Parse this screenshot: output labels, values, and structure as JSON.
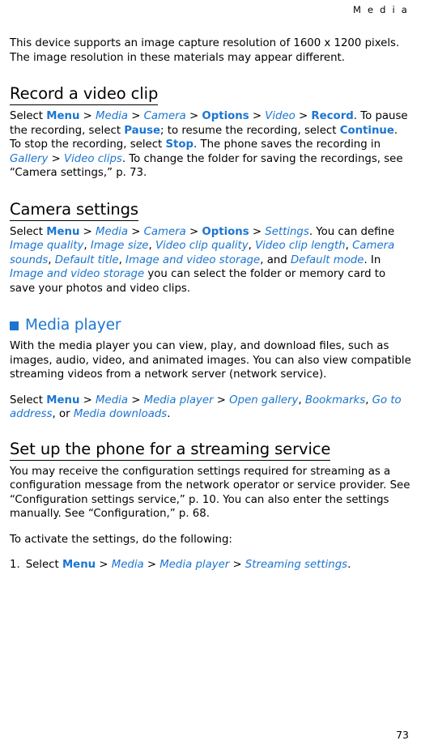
{
  "header": {
    "running_head": "M e d i a"
  },
  "intro": {
    "text": "This device supports an image capture resolution of 1600 x 1200 pixels. The image resolution in these materials may appear different."
  },
  "sections": {
    "record_video": {
      "heading": "Record a video clip",
      "p1_a": "Select ",
      "p1_menu": "Menu",
      "p1_sep1": " > ",
      "p1_media": "Media",
      "p1_sep2": " > ",
      "p1_camera": "Camera",
      "p1_sep3": " > ",
      "p1_options": "Options",
      "p1_sep4": " > ",
      "p1_video": "Video",
      "p1_sep5": " > ",
      "p1_record": "Record",
      "p1_b": ". To pause the recording, select ",
      "p1_pause": "Pause",
      "p1_c": "; to resume the recording, select ",
      "p1_continue": "Continue",
      "p1_d": ". To stop the recording, select ",
      "p1_stop": "Stop",
      "p1_e": ". The phone saves the recording in ",
      "p1_gallery": "Gallery",
      "p1_sep6": " > ",
      "p1_videoclips": "Video clips",
      "p1_f": ". To change the folder for saving the recordings, see “Camera settings,” p. 73."
    },
    "camera_settings": {
      "heading": "Camera settings",
      "p1_a": "Select ",
      "p1_menu": "Menu",
      "p1_sep1": " > ",
      "p1_media": "Media",
      "p1_sep2": " > ",
      "p1_camera": "Camera",
      "p1_sep3": " > ",
      "p1_options": "Options",
      "p1_sep4": " > ",
      "p1_settings": "Settings",
      "p1_b": ". You can define ",
      "p1_imagequality": "Image quality",
      "p1_c1": ", ",
      "p1_imagesize": "Image size",
      "p1_c2": ", ",
      "p1_videoclipquality": "Video clip quality",
      "p1_c3": ", ",
      "p1_videocliplength": "Video clip length",
      "p1_c4": ", ",
      "p1_camerasounds": "Camera sounds",
      "p1_c5": ", ",
      "p1_defaulttitle": "Default title",
      "p1_c6": ", ",
      "p1_imageandvideostorage": "Image and video storage",
      "p1_c7": ", and ",
      "p1_defaultmode": "Default mode",
      "p1_d": ". In ",
      "p1_imageandvideostorage2": "Image and video storage",
      "p1_e": " you can select the folder or memory card to save your photos and video clips."
    },
    "media_player": {
      "heading": "Media player",
      "p1": "With the media player you can view, play, and download files, such as images, audio, video, and animated images. You can also view compatible streaming videos from a network server (network service).",
      "p2_a": "Select ",
      "p2_menu": "Menu",
      "p2_sep1": " > ",
      "p2_media": "Media",
      "p2_sep2": " > ",
      "p2_mediaplayer": "Media player",
      "p2_sep3": " > ",
      "p2_opengallery": "Open gallery",
      "p2_c1": ", ",
      "p2_bookmarks": "Bookmarks",
      "p2_c2": ", ",
      "p2_gotoaddress": "Go to address",
      "p2_c3": ", or ",
      "p2_mediadownloads": "Media downloads",
      "p2_end": "."
    },
    "streaming": {
      "heading": "Set up the phone for a streaming service",
      "p1": "You may receive the configuration settings required for streaming as a configuration message from the network operator or service provider. See “Configuration settings service,” p. 10. You can also enter the settings manually. See “Configuration,” p. 68.",
      "p2": "To activate the settings, do the following:",
      "item1_num": "1.",
      "item1_a": "Select ",
      "item1_menu": "Menu",
      "item1_sep1": " > ",
      "item1_media": "Media",
      "item1_sep2": " > ",
      "item1_mediaplayer": "Media player",
      "item1_sep3": " > ",
      "item1_streamingsettings": "Streaming settings",
      "item1_end": "."
    }
  },
  "footer": {
    "page_number": "73"
  },
  "colors": {
    "accent": "#1c75d1",
    "text": "#000000",
    "background": "#ffffff"
  }
}
